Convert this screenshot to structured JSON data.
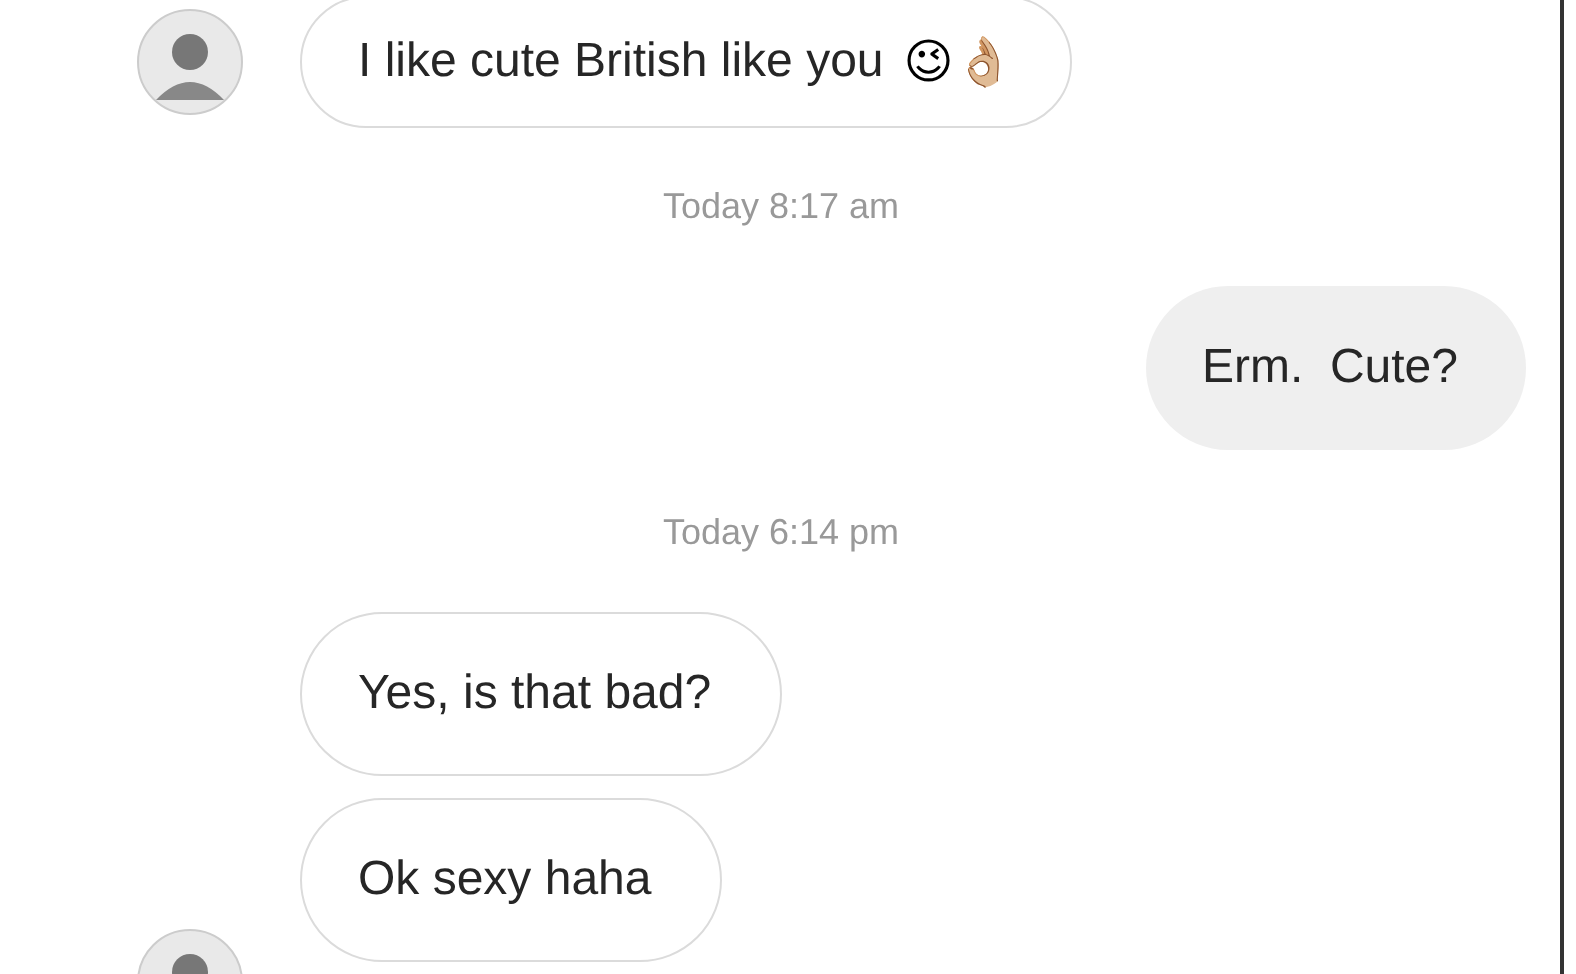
{
  "thread": [
    {
      "kind": "incoming",
      "avatar": true,
      "text": "I like cute British like you",
      "emoji": "😉👌🏼"
    },
    {
      "kind": "timestamp",
      "text": "Today 8:17 am"
    },
    {
      "kind": "outgoing",
      "text": "Erm.  Cute?"
    },
    {
      "kind": "timestamp",
      "text": "Today 6:14 pm"
    },
    {
      "kind": "incoming",
      "avatar": false,
      "text": "Yes, is that bad?"
    },
    {
      "kind": "incoming",
      "avatar": true,
      "text": "Ok sexy haha"
    }
  ]
}
